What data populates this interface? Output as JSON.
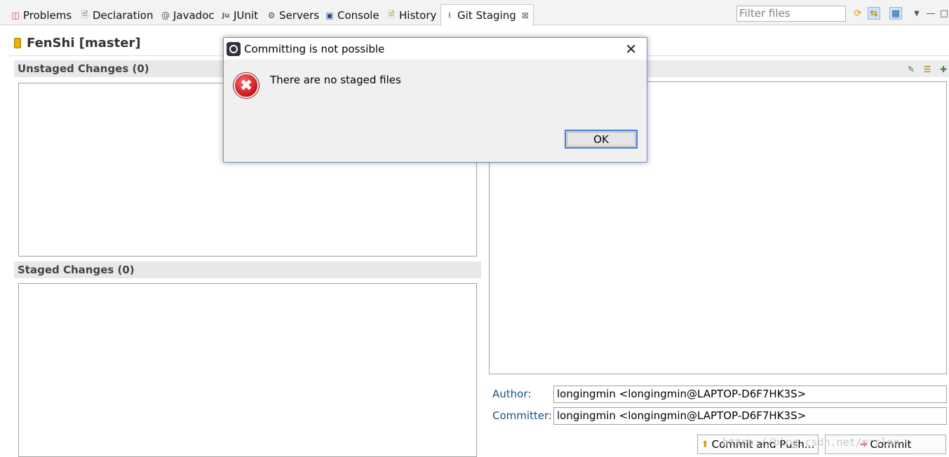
{
  "tabs": [
    {
      "label": "Problems",
      "icon": "problems-icon"
    },
    {
      "label": "Declaration",
      "icon": "declaration-icon"
    },
    {
      "label": "Javadoc",
      "icon": "javadoc-icon"
    },
    {
      "label": "JUnit",
      "icon": "junit-icon"
    },
    {
      "label": "Servers",
      "icon": "servers-icon"
    },
    {
      "label": "Console",
      "icon": "console-icon"
    },
    {
      "label": "History",
      "icon": "history-icon"
    },
    {
      "label": "Git Staging",
      "icon": "git-staging-icon",
      "active": true
    }
  ],
  "filter": {
    "placeholder": "Filter files"
  },
  "repo": {
    "title": "FenShi [master]"
  },
  "unstaged": {
    "title": "Unstaged Changes (0)"
  },
  "staged": {
    "title": "Staged Changes (0)"
  },
  "author": {
    "label": "Author:",
    "value": "longingmin <longingmin@LAPTOP-D6F7HK3S>"
  },
  "committer": {
    "label": "Committer:",
    "value": "longingmin <longingmin@LAPTOP-D6F7HK3S>"
  },
  "buttons": {
    "commit_push": "Commit and Push...",
    "commit": "Commit"
  },
  "watermark": "https://blog.csdn.net/mrslon",
  "dialog": {
    "title": "Committing is not possible",
    "message": "There are no staged files",
    "ok": "OK"
  },
  "colors": {
    "accent": "#3c7fd6",
    "error": "#c8141a",
    "label_blue": "#1d4f8a"
  }
}
